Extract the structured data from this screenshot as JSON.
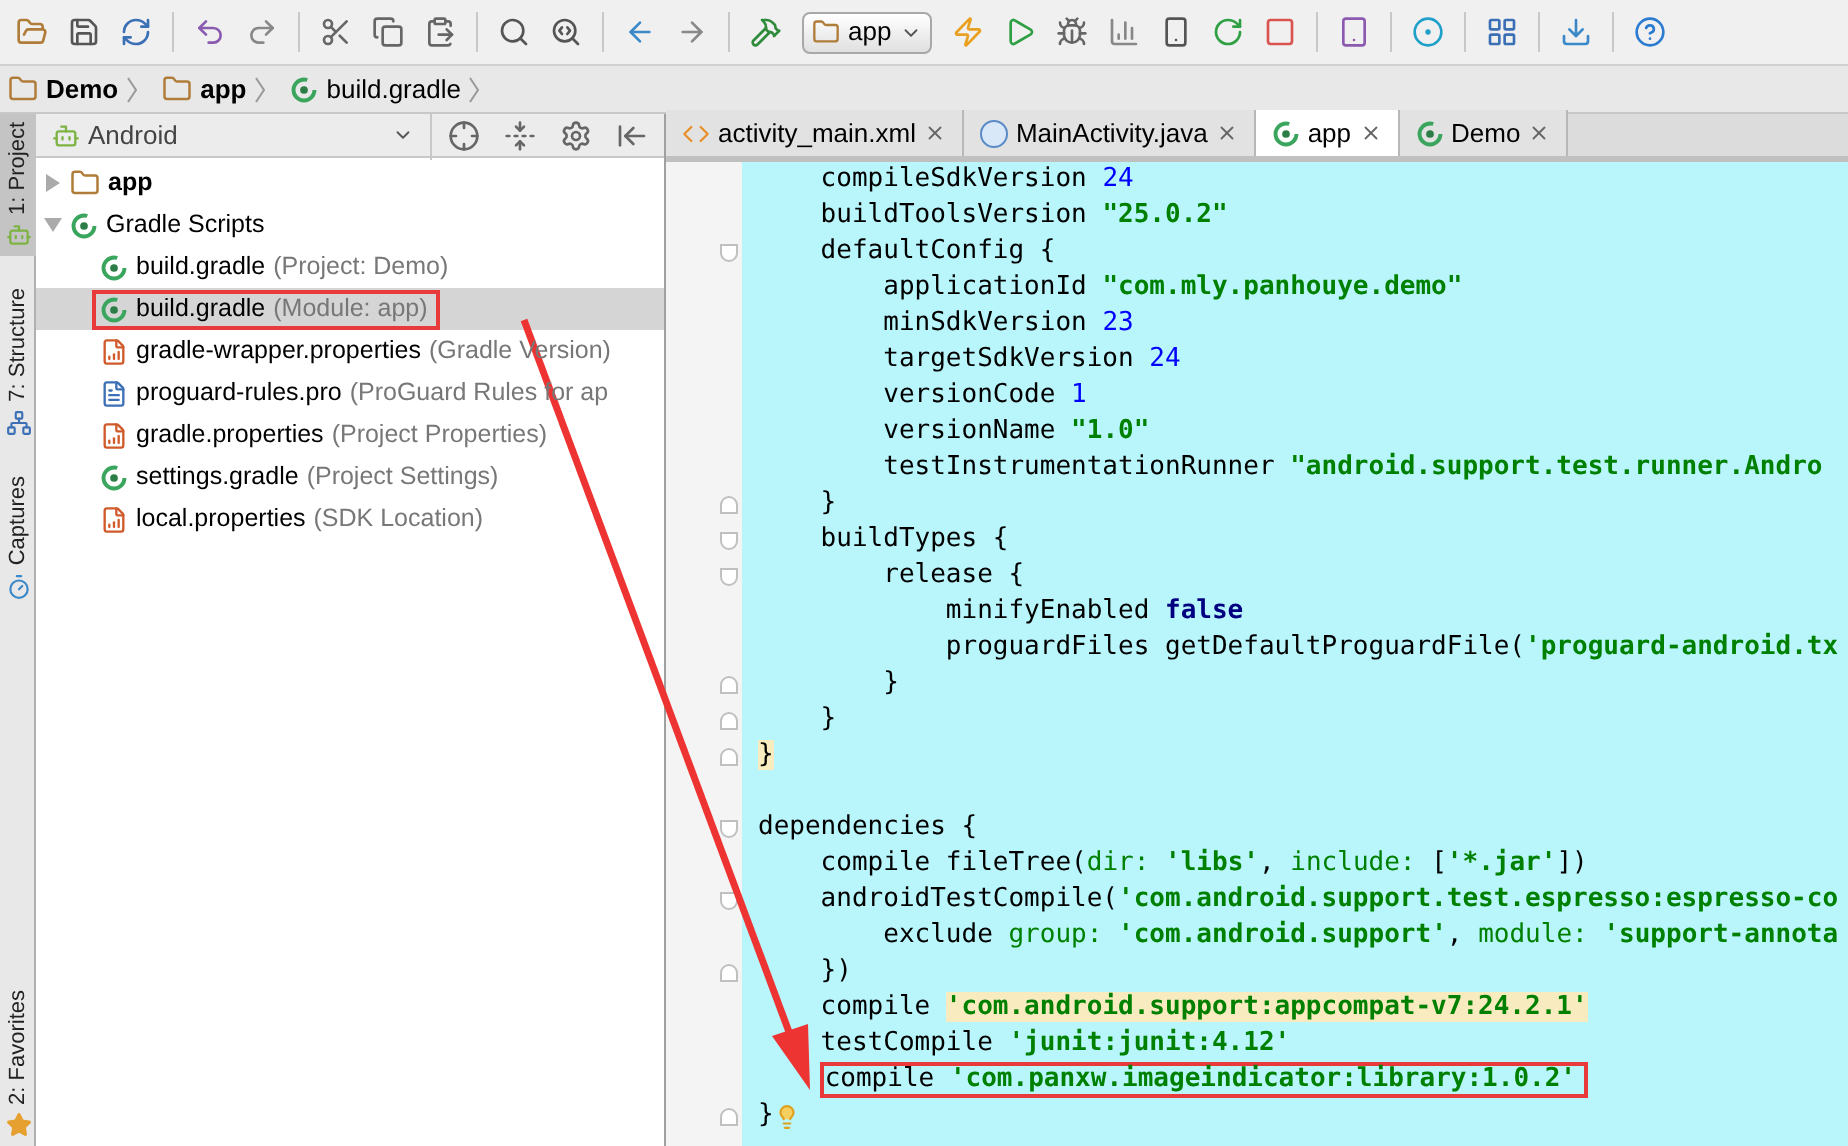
{
  "toolbar": {
    "run_config": "app"
  },
  "breadcrumbs": [
    {
      "label": "Demo",
      "kind": "folder"
    },
    {
      "label": "app",
      "kind": "module"
    },
    {
      "label": "build.gradle",
      "kind": "gradle"
    }
  ],
  "tool_strip": [
    {
      "label": "1: Project",
      "selected": true,
      "kind": "android"
    },
    {
      "label": "7: Structure",
      "selected": false,
      "kind": "structure"
    },
    {
      "label": "Captures",
      "selected": false,
      "kind": "captures"
    }
  ],
  "tool_strip_bottom": [
    {
      "label": "2: Favorites",
      "selected": false,
      "kind": "star"
    }
  ],
  "project_panel": {
    "view": "Android",
    "tree": [
      {
        "name": "app",
        "kind": "folder",
        "expanded": false,
        "bold": true
      },
      {
        "name": "Gradle Scripts",
        "kind": "gradle",
        "expanded": true,
        "bold": false,
        "children": [
          {
            "name": "build.gradle",
            "hint": "(Project: Demo)",
            "kind": "gradle",
            "selected": false,
            "boxed": false
          },
          {
            "name": "build.gradle",
            "hint": "(Module: app)",
            "kind": "gradle",
            "selected": true,
            "boxed": true
          },
          {
            "name": "gradle-wrapper.properties",
            "hint": "(Gradle Version)",
            "kind": "properties",
            "selected": false,
            "boxed": false
          },
          {
            "name": "proguard-rules.pro",
            "hint": "(ProGuard Rules for ap",
            "kind": "text",
            "selected": false,
            "boxed": false
          },
          {
            "name": "gradle.properties",
            "hint": "(Project Properties)",
            "kind": "properties",
            "selected": false,
            "boxed": false
          },
          {
            "name": "settings.gradle",
            "hint": "(Project Settings)",
            "kind": "gradle",
            "selected": false,
            "boxed": false
          },
          {
            "name": "local.properties",
            "hint": "(SDK Location)",
            "kind": "properties",
            "selected": false,
            "boxed": false
          }
        ]
      }
    ]
  },
  "editor_tabs": [
    {
      "label": "activity_main.xml",
      "kind": "xml",
      "selected": false
    },
    {
      "label": "MainActivity.java",
      "kind": "java",
      "selected": false
    },
    {
      "label": "app",
      "kind": "gradle",
      "selected": true
    },
    {
      "label": "Demo",
      "kind": "gradle",
      "selected": false
    }
  ],
  "code_lines": [
    {
      "tokens": [
        {
          "kind": "plain",
          "text": "    compileSdkVersion "
        },
        {
          "kind": "number",
          "text": "24"
        }
      ]
    },
    {
      "tokens": [
        {
          "kind": "plain",
          "text": "    buildToolsVersion "
        },
        {
          "kind": "string",
          "text": "\"25.0.2\""
        }
      ]
    },
    {
      "fold_start": true,
      "tokens": [
        {
          "kind": "plain",
          "text": "    defaultConfig {"
        }
      ]
    },
    {
      "tokens": [
        {
          "kind": "plain",
          "text": "        applicationId "
        },
        {
          "kind": "string",
          "text": "\"com.mly.panhouye.demo\""
        }
      ]
    },
    {
      "tokens": [
        {
          "kind": "plain",
          "text": "        minSdkVersion "
        },
        {
          "kind": "number",
          "text": "23"
        }
      ]
    },
    {
      "tokens": [
        {
          "kind": "plain",
          "text": "        targetSdkVersion "
        },
        {
          "kind": "number",
          "text": "24"
        }
      ]
    },
    {
      "tokens": [
        {
          "kind": "plain",
          "text": "        versionCode "
        },
        {
          "kind": "number",
          "text": "1"
        }
      ]
    },
    {
      "tokens": [
        {
          "kind": "plain",
          "text": "        versionName "
        },
        {
          "kind": "string",
          "text": "\"1.0\""
        }
      ]
    },
    {
      "tokens": [
        {
          "kind": "plain",
          "text": "        testInstrumentationRunner "
        },
        {
          "kind": "string",
          "text": "\"android.support.test.runner.Andro"
        }
      ]
    },
    {
      "fold_end": true,
      "tokens": [
        {
          "kind": "plain",
          "text": "    }"
        }
      ]
    },
    {
      "fold_start": true,
      "tokens": [
        {
          "kind": "plain",
          "text": "    buildTypes {"
        }
      ]
    },
    {
      "fold_start": true,
      "tokens": [
        {
          "kind": "plain",
          "text": "        release {"
        }
      ]
    },
    {
      "tokens": [
        {
          "kind": "plain",
          "text": "            minifyEnabled "
        },
        {
          "kind": "keyword",
          "text": "false"
        }
      ]
    },
    {
      "tokens": [
        {
          "kind": "plain",
          "text": "            proguardFiles getDefaultProguardFile("
        },
        {
          "kind": "string",
          "text": "'proguard-android.tx"
        }
      ]
    },
    {
      "fold_end": true,
      "tokens": [
        {
          "kind": "plain",
          "text": "        }"
        }
      ]
    },
    {
      "fold_end": true,
      "tokens": [
        {
          "kind": "plain",
          "text": "    }"
        }
      ]
    },
    {
      "fold_end": true,
      "tokens": [
        {
          "kind": "plain",
          "text": "}",
          "highlighted": true
        }
      ]
    },
    {
      "blank": true
    },
    {
      "fold_start": true,
      "tokens": [
        {
          "kind": "plain",
          "text": "dependencies {"
        }
      ]
    },
    {
      "tokens": [
        {
          "kind": "plain",
          "text": "    compile fileTree("
        },
        {
          "kind": "label",
          "text": "dir: "
        },
        {
          "kind": "string",
          "text": "'libs'"
        },
        {
          "kind": "plain",
          "text": ", "
        },
        {
          "kind": "label",
          "text": "include: "
        },
        {
          "kind": "plain",
          "text": "["
        },
        {
          "kind": "string",
          "text": "'*.jar'"
        },
        {
          "kind": "plain",
          "text": "])"
        }
      ]
    },
    {
      "fold_start": true,
      "tokens": [
        {
          "kind": "plain",
          "text": "    androidTestCompile("
        },
        {
          "kind": "string",
          "text": "'com.android.support.test.espresso:espresso-co"
        }
      ]
    },
    {
      "tokens": [
        {
          "kind": "plain",
          "text": "        exclude "
        },
        {
          "kind": "label",
          "text": "group: "
        },
        {
          "kind": "string",
          "text": "'com.android.support'"
        },
        {
          "kind": "plain",
          "text": ", "
        },
        {
          "kind": "label",
          "text": "module: "
        },
        {
          "kind": "string",
          "text": "'support-annota"
        }
      ]
    },
    {
      "fold_end": true,
      "tokens": [
        {
          "kind": "plain",
          "text": "    })"
        }
      ]
    },
    {
      "tokens": [
        {
          "kind": "plain",
          "text": "    compile "
        },
        {
          "kind": "string",
          "text": "'com.android.support:appcompat-v7:24.2.1'",
          "highlighted": true
        }
      ]
    },
    {
      "tokens": [
        {
          "kind": "plain",
          "text": "    testCompile "
        },
        {
          "kind": "string",
          "text": "'junit:junit:4.12'"
        }
      ]
    },
    {
      "boxed": true,
      "tokens": [
        {
          "kind": "plain",
          "text": "    compile "
        },
        {
          "kind": "string",
          "text": "'com.panxw.imageindicator:library:1.0.2'"
        }
      ]
    },
    {
      "fold_end": true,
      "bulb": true,
      "tokens": [
        {
          "kind": "plain",
          "text": "}"
        }
      ]
    }
  ]
}
